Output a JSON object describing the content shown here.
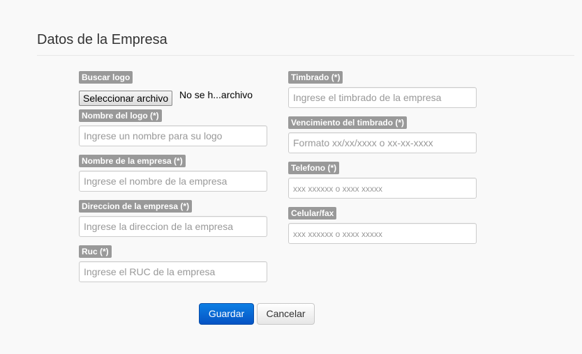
{
  "form": {
    "title": "Datos de la Empresa",
    "left": {
      "logo_label": "Buscar logo",
      "file_button": "Seleccionar archivo",
      "file_status": "No se h...archivo",
      "logo_name_label": "Nombre del logo (*)",
      "logo_name_placeholder": "Ingrese un nombre para su logo",
      "company_name_label": "Nombre de la empresa (*)",
      "company_name_placeholder": "Ingrese el nombre de la empresa",
      "address_label": "Direccion de la empresa (*)",
      "address_placeholder": "Ingrese la direccion de la empresa",
      "ruc_label": "Ruc (*)",
      "ruc_placeholder": "Ingrese el RUC de la empresa"
    },
    "right": {
      "timbrado_label": "Timbrado (*)",
      "timbrado_placeholder": "Ingrese el timbrado de la empresa",
      "vencimiento_label": "Vencimiento del timbrado (*)",
      "vencimiento_placeholder": "Formato xx/xx/xxxx o xx-xx-xxxx",
      "telefono_label": "Telefono (*)",
      "telefono_placeholder": "xxx xxxxxx o xxxx xxxxx",
      "celular_label": "Celular/fax",
      "celular_placeholder": "xxx xxxxxx o xxxx xxxxx"
    },
    "actions": {
      "save_label": "Guardar",
      "cancel_label": "Cancelar"
    }
  },
  "colors": {
    "primary": "#0b67d6",
    "label_bg": "#999999",
    "background": "#f9f9f9"
  }
}
